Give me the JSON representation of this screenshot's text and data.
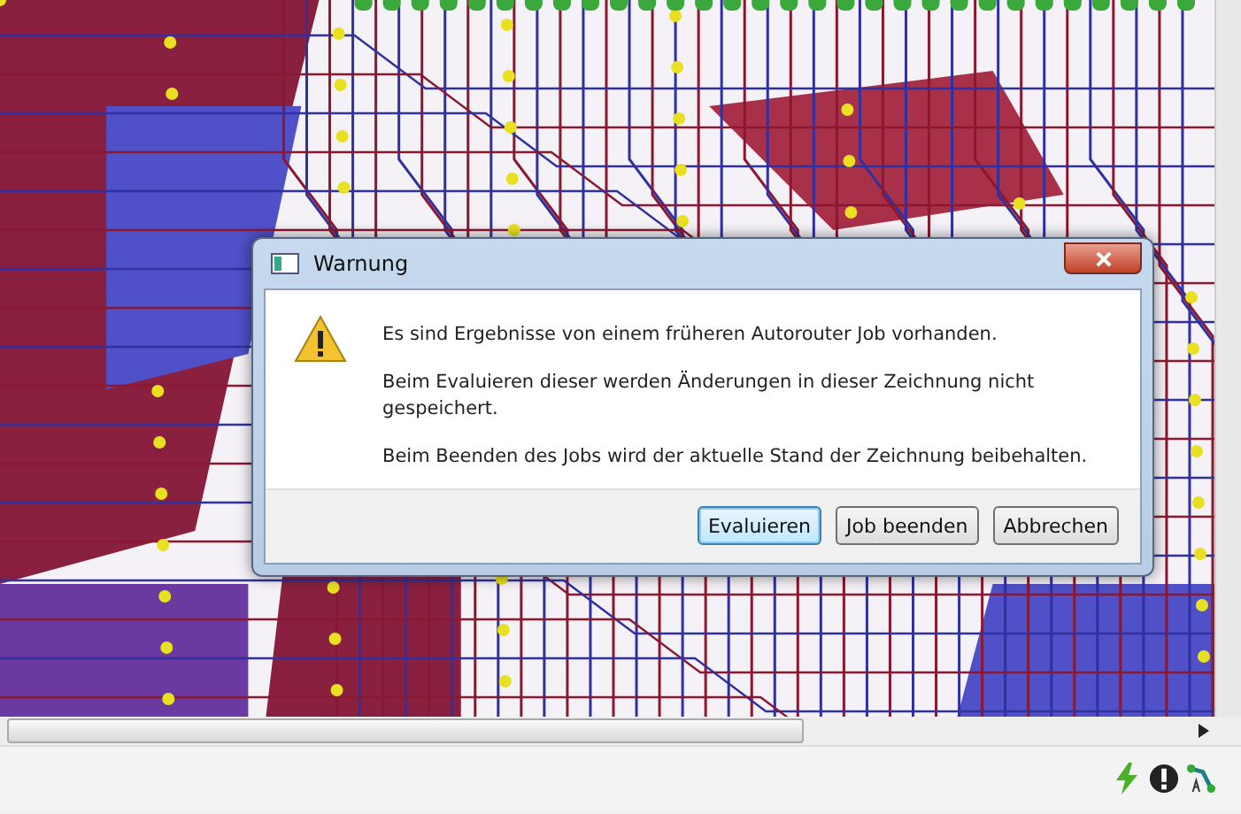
{
  "dialog": {
    "title": "Warnung",
    "messages": [
      "Es sind Ergebnisse von einem früheren Autorouter Job vorhanden.",
      "Beim Evaluieren dieser werden Änderungen in dieser Zeichnung nicht gespeichert.",
      "Beim Beenden des Jobs wird der aktuelle Stand der Zeichnung beibehalten."
    ],
    "buttons": [
      {
        "label": "Evaluieren",
        "selected": true
      },
      {
        "label": "Job beenden",
        "selected": false
      },
      {
        "label": "Abbrechen",
        "selected": false
      }
    ]
  }
}
